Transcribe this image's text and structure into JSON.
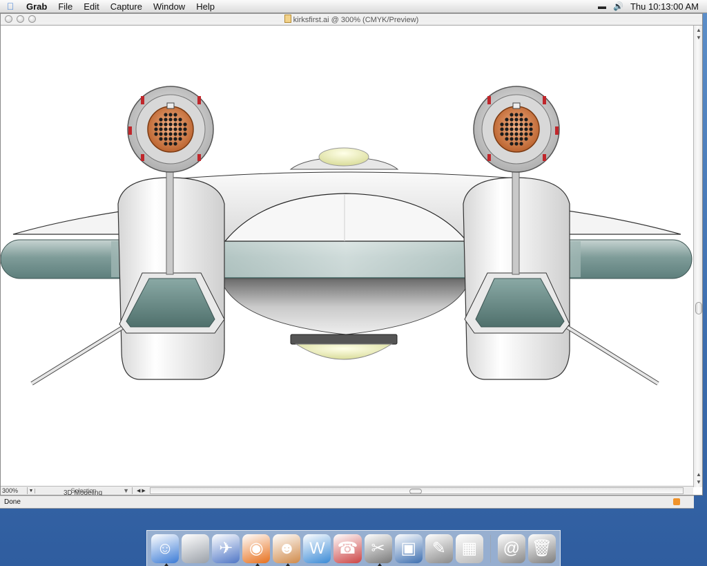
{
  "menubar": {
    "apple_icon": "apple-logo-icon",
    "app_name": "Grab",
    "items": [
      "File",
      "Edit",
      "Capture",
      "Window",
      "Help"
    ],
    "status_icons": [
      "display-icon",
      "volume-icon"
    ],
    "clock": "Thu 10:13:00 AM"
  },
  "window": {
    "title": "kirksfirst.ai @ 300% (CMYK/Preview)",
    "zoom": "300%",
    "mode": "Selection"
  },
  "browser": {
    "status": "Done",
    "behind_text": "3D Modeling"
  },
  "dock": {
    "items": [
      {
        "name": "finder-icon",
        "glyph": "☺",
        "color": "#3b7bd6"
      },
      {
        "name": "system-preferences-icon",
        "glyph": "",
        "color": "#9aa0a8"
      },
      {
        "name": "mail-stamp-icon",
        "glyph": "✈",
        "color": "#4f76c6"
      },
      {
        "name": "firefox-icon",
        "glyph": "◉",
        "color": "#e7701c"
      },
      {
        "name": "photo-app-icon",
        "glyph": "☻",
        "color": "#d08a4a"
      },
      {
        "name": "word-icon",
        "glyph": "W",
        "color": "#3a8ad6"
      },
      {
        "name": "instant-message-icon",
        "glyph": "☎",
        "color": "#c44"
      },
      {
        "name": "cut-tools-icon",
        "glyph": "✂",
        "color": "#777"
      },
      {
        "name": "iphoto-icon",
        "glyph": "▣",
        "color": "#3e6fb0"
      },
      {
        "name": "textedit-icon",
        "glyph": "✎",
        "color": "#8a8a8a"
      },
      {
        "name": "calculator-icon",
        "glyph": "▦",
        "color": "#b9b9b9"
      },
      {
        "name": "internet-location-icon",
        "glyph": "@",
        "color": "#888"
      },
      {
        "name": "trash-icon",
        "glyph": "🗑",
        "color": "#7d7d7d"
      }
    ]
  }
}
